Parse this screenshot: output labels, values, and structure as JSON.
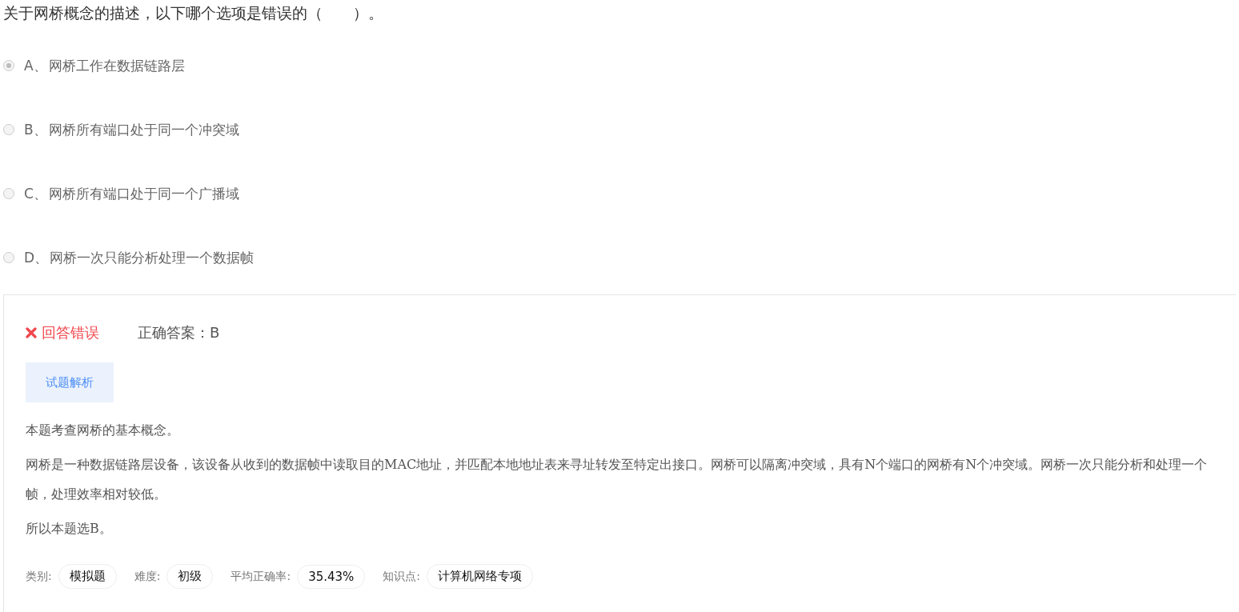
{
  "question": "关于网桥概念的描述，以下哪个选项是错误的（　　）。",
  "options": [
    {
      "letter": "A、",
      "text": "网桥工作在数据链路层",
      "selected": true
    },
    {
      "letter": "B、",
      "text": "网桥所有端口处于同一个冲突域",
      "selected": false
    },
    {
      "letter": "C、",
      "text": "网桥所有端口处于同一个广播域",
      "selected": false
    },
    {
      "letter": "D、",
      "text": "网桥一次只能分析处理一个数据帧",
      "selected": false
    }
  ],
  "result": {
    "status": "回答错误",
    "correct": false,
    "answer_label": "正确答案：B"
  },
  "tabs": [
    {
      "label": "试题解析",
      "selected": true
    }
  ],
  "analysis": [
    "本题考查网桥的基本概念。",
    "网桥是一种数据链路层设备，该设备从收到的数据帧中读取目的MAC地址，并匹配本地地址表来寻址转发至特定出接口。网桥可以隔离冲突域，具有N个端口的网桥有N个冲突域。网桥一次只能分析和处理一个帧，处理效率相对较低。",
    "所以本题选B。"
  ],
  "meta": [
    {
      "label": "类别:",
      "value": "模拟题"
    },
    {
      "label": "难度:",
      "value": "初级"
    },
    {
      "label": "平均正确率:",
      "value": "35.43%"
    },
    {
      "label": "知识点:",
      "value": "计算机网络专项"
    }
  ]
}
